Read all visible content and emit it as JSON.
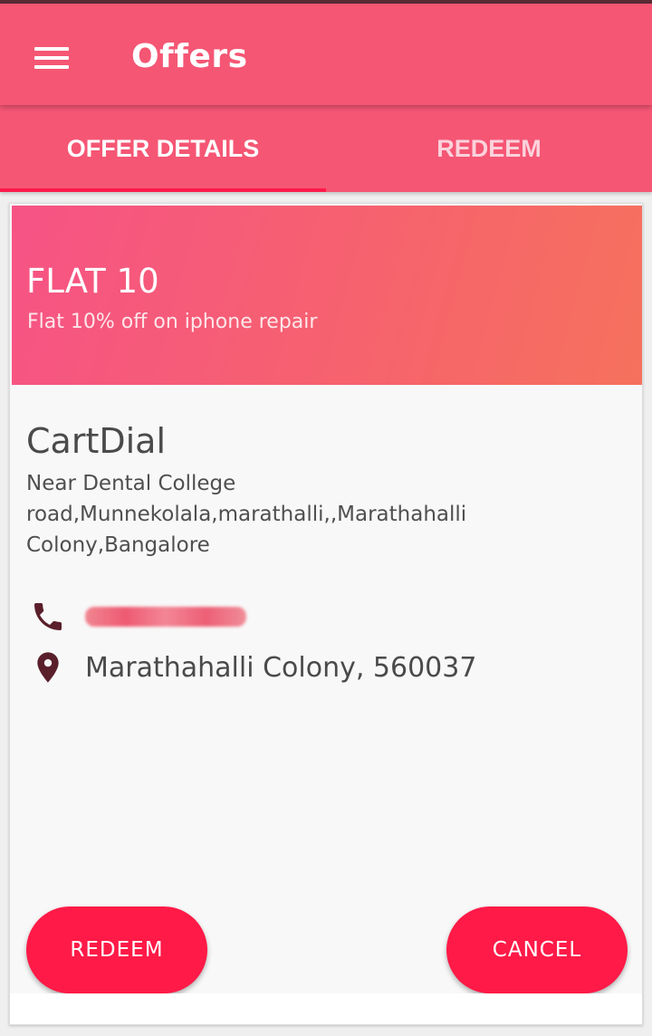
{
  "appbar": {
    "title": "Offers",
    "menu_icon": "hamburger-menu-icon"
  },
  "tabs": [
    {
      "label": "OFFER DETAILS",
      "selected": true
    },
    {
      "label": "REDEEM",
      "selected": false
    }
  ],
  "colors": {
    "primary": "#f55674",
    "accent": "#ff1a47",
    "icon": "#5a1f2b"
  },
  "offer": {
    "title": "FLAT 10",
    "subtitle": "Flat 10% off on iphone repair"
  },
  "business": {
    "name": "CartDial",
    "address": "Near Dental College road,Munnekolala,marathalli,,Marathahalli Colony,Bangalore",
    "location": "Marathahalli Colony, 560037"
  },
  "actions": {
    "redeem_label": "REDEEM",
    "cancel_label": "CANCEL"
  }
}
